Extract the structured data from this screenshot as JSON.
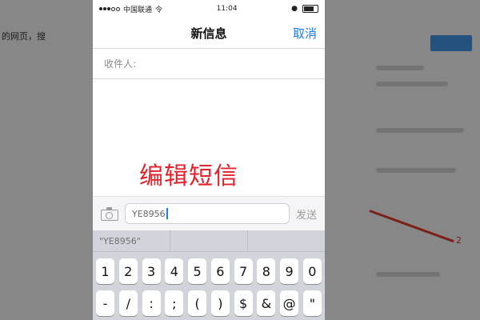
{
  "background": {
    "text_fragment": "的网页，搜",
    "arrow_number": "2"
  },
  "status_bar": {
    "carrier": "中国联通",
    "network": "令",
    "time": "11:04"
  },
  "nav": {
    "title": "新信息",
    "cancel_label": "取消"
  },
  "recipient": {
    "label": "收件人:"
  },
  "annotation": {
    "text": "编辑短信"
  },
  "compose": {
    "text": "YE8956",
    "send_label": "发送"
  },
  "keyboard": {
    "suggestions": [
      "\"YE8956\"",
      "",
      ""
    ],
    "number_row": [
      "1",
      "2",
      "3",
      "4",
      "5",
      "6",
      "7",
      "8",
      "9",
      "0"
    ],
    "symbol_row": [
      "-",
      "/",
      ":",
      ";",
      "(",
      ")",
      "$",
      "&",
      "@",
      "\""
    ]
  },
  "colors": {
    "accent": "#1a7cf2",
    "annotation": "#e2222a"
  }
}
